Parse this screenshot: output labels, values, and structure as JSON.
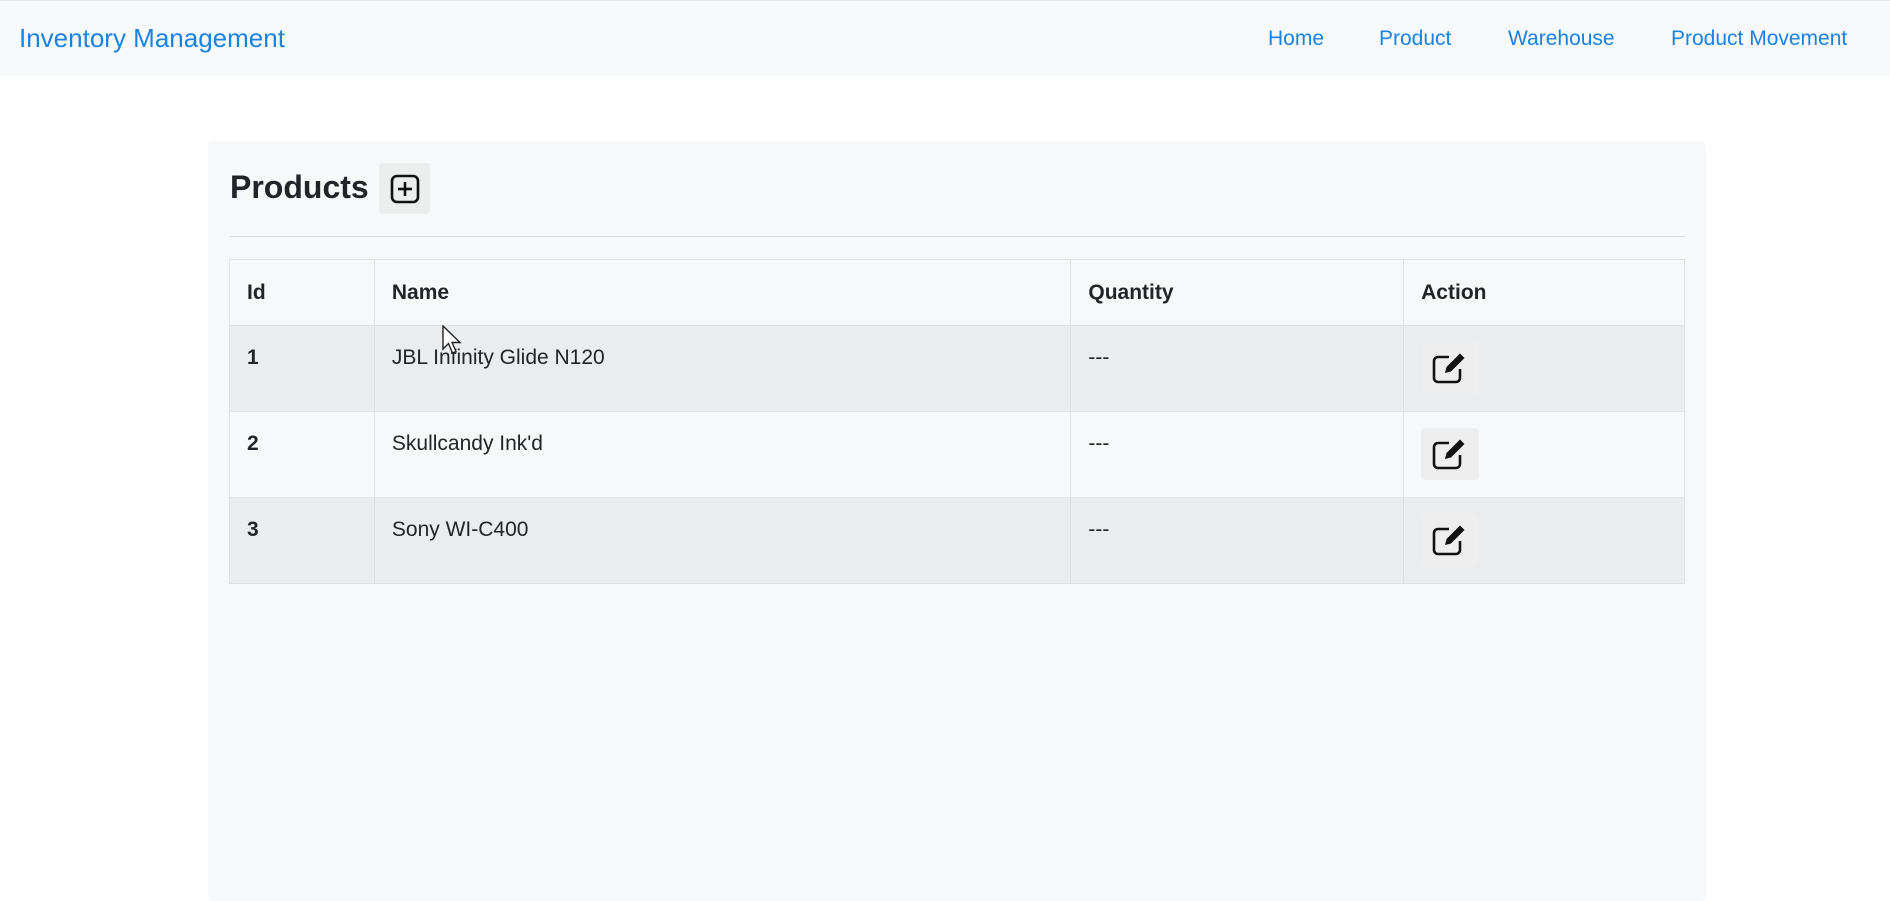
{
  "navbar": {
    "brand": "Inventory Management",
    "links": [
      "Home",
      "Product",
      "Warehouse",
      "Product Movement"
    ],
    "link_color": "#1a82e2"
  },
  "page": {
    "title": "Products",
    "add_icon": "plus-square-icon",
    "edit_icon": "pencil-square-icon"
  },
  "table": {
    "headers": [
      "Id",
      "Name",
      "Quantity",
      "Action"
    ],
    "rows": [
      {
        "id": "1",
        "name": "JBL Infinity Glide N120",
        "quantity": "---"
      },
      {
        "id": "2",
        "name": "Skullcandy Ink'd",
        "quantity": "---"
      },
      {
        "id": "3",
        "name": "Sony WI-C400",
        "quantity": "---"
      }
    ]
  }
}
